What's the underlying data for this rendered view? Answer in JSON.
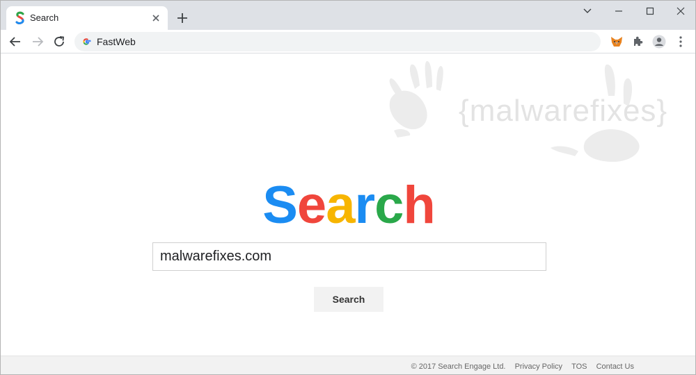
{
  "browser": {
    "tab_title": "Search",
    "address": "FastWeb",
    "new_tab_symbol": "+"
  },
  "watermark": {
    "text": "{malwarefixes}"
  },
  "page": {
    "logo_letters": [
      "S",
      "e",
      "a",
      "r",
      "c",
      "h"
    ],
    "logo_colors": [
      "#1b8cf2",
      "#f0463c",
      "#f7b500",
      "#1b8cf2",
      "#2aa84a",
      "#f0463c"
    ],
    "search_value": "malwarefixes.com",
    "search_button": "Search"
  },
  "footer": {
    "copyright": "© 2017 Search Engage Ltd.",
    "privacy": "Privacy Policy",
    "tos": "TOS",
    "contact": "Contact Us"
  }
}
